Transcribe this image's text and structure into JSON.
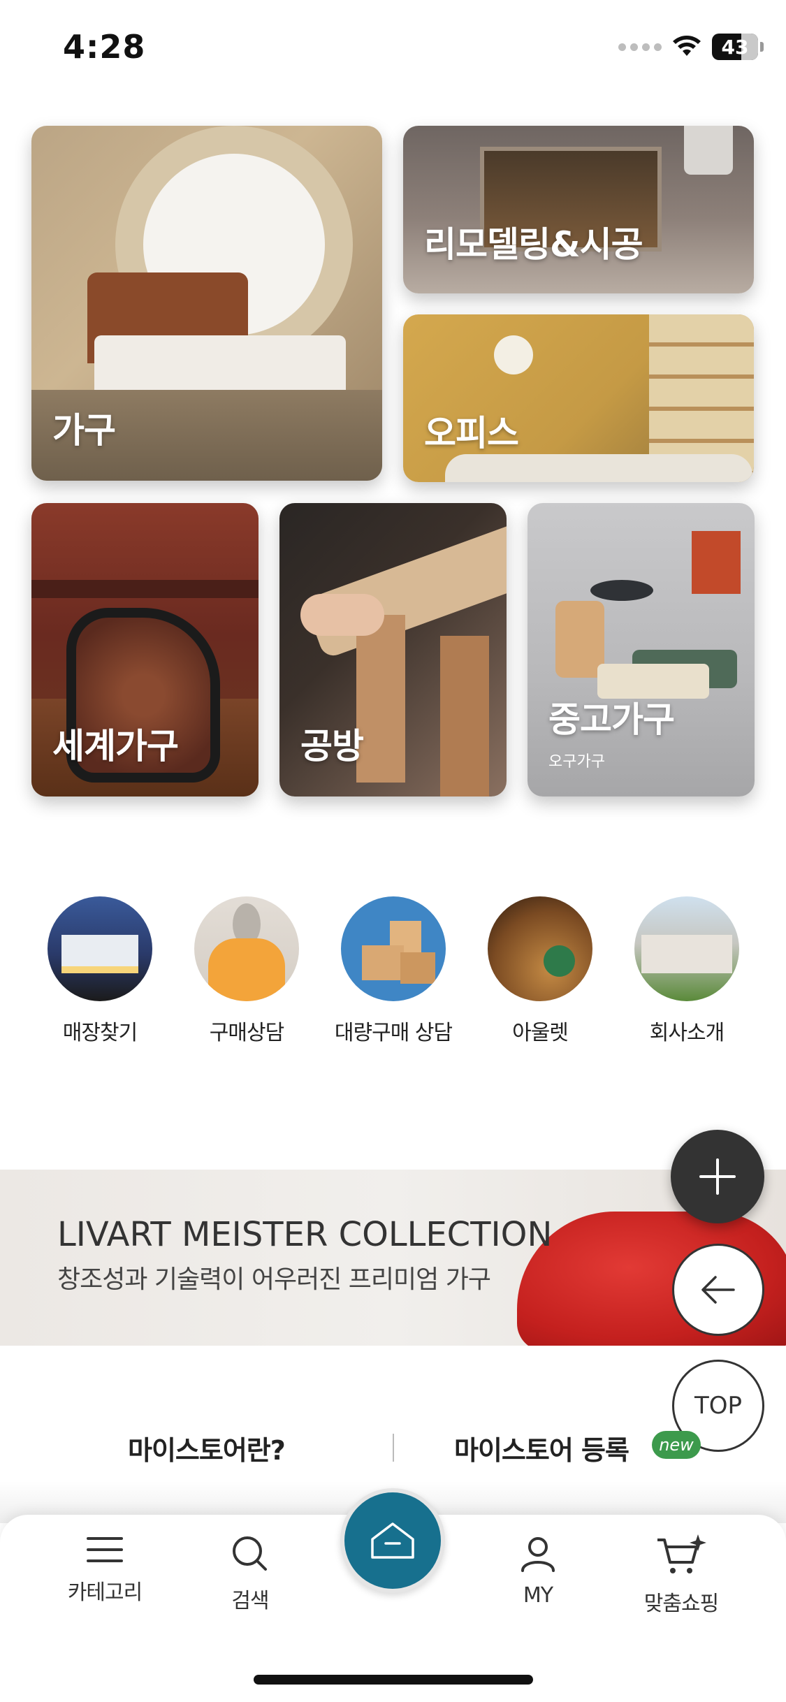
{
  "status_bar": {
    "time": "4:28",
    "battery": "43"
  },
  "categories": [
    {
      "label": "가구"
    },
    {
      "label": "리모델링&시공"
    },
    {
      "label": "오피스"
    },
    {
      "label": "세계가구"
    },
    {
      "label": "공방"
    },
    {
      "label": "중고가구",
      "sublabel": "오구가구"
    }
  ],
  "quick_links": [
    {
      "label": "매장찾기"
    },
    {
      "label": "구매상담"
    },
    {
      "label": "대량구매 상담"
    },
    {
      "label": "아울렛"
    },
    {
      "label": "회사소개"
    }
  ],
  "banner": {
    "title": "LIVART MEISTER COLLECTION",
    "subtitle": "창조성과 기술력이 어우러진 프리미엄 가구"
  },
  "meister": {
    "about": "마이스토어란?",
    "register": "마이스토어 등록",
    "new_badge": "new"
  },
  "floating": {
    "top_label": "TOP"
  },
  "bottom_nav": {
    "category": "카테고리",
    "search": "검색",
    "my": "MY",
    "custom_shopping": "맞춤쇼핑"
  },
  "colors": {
    "brand_teal": "#17708e",
    "new_badge_green": "#3c9a4c",
    "fab_dark": "#333333"
  }
}
